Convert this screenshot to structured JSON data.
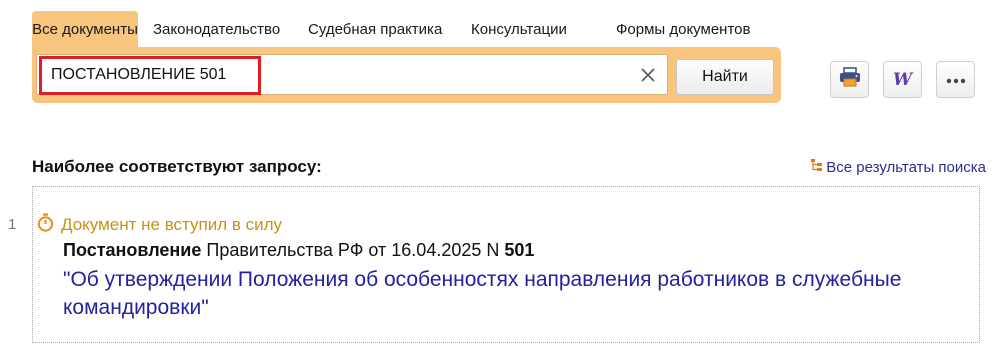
{
  "tabs": [
    {
      "label": "Все документы",
      "active": true
    },
    {
      "label": "Законодательство",
      "active": false
    },
    {
      "label": "Судебная практика",
      "active": false
    },
    {
      "label": "Консультации",
      "active": false
    },
    {
      "label": "Формы документов",
      "active": false
    }
  ],
  "search": {
    "value": "ПОСТАНОВЛЕНИЕ 501",
    "button_label": "Найти"
  },
  "toolbar": {
    "print_icon": "printer-icon",
    "word_icon": "word-export-icon",
    "word_label": "W",
    "more_label": "•••"
  },
  "results": {
    "heading": "Наиболее соответствуют запросу:",
    "all_results_label": "Все результаты поиска",
    "items": [
      {
        "number": "1",
        "status": "Документ не вступил в силу",
        "doc_type": "Постановление",
        "issuer_date": "Правительства РФ от 16.04.2025 N",
        "doc_number": "501",
        "title": "\"Об утверждении Положения об особенностях направления работников в служебные командировки\""
      }
    ]
  },
  "colors": {
    "accent": "#f8c57f",
    "highlight": "#e11d24",
    "link": "#22229e",
    "status": "#c69312"
  }
}
